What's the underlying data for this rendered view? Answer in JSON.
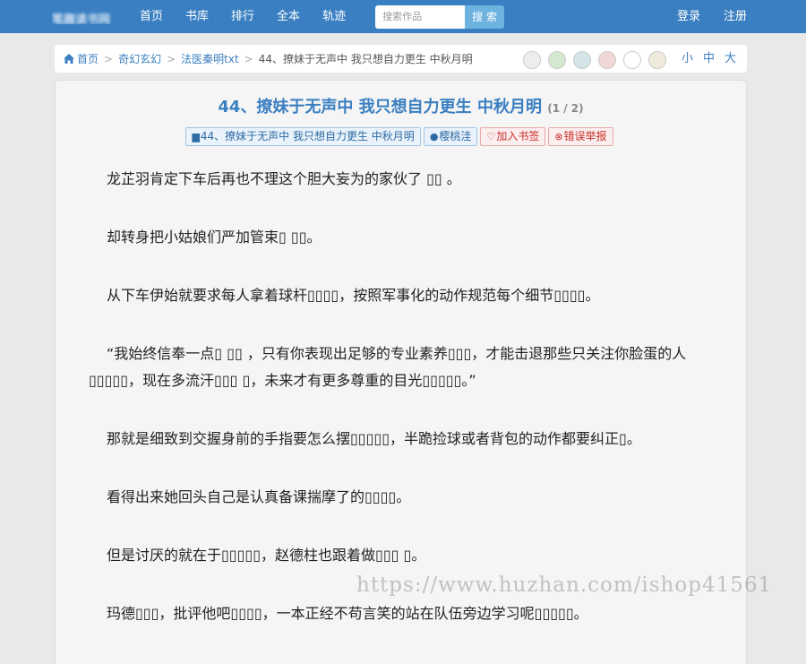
{
  "logo": {
    "text": "笔趣读书网"
  },
  "nav": [
    "首页",
    "书库",
    "排行",
    "全本",
    "轨迹"
  ],
  "search": {
    "placeholder": "搜索作品",
    "button": "搜 索"
  },
  "auth": {
    "login": "登录",
    "register": "注册"
  },
  "breadcrumb": {
    "home": "首页",
    "category": "奇幻玄幻",
    "book": "法医秦明txt",
    "chapter": "44、撩妹于无声中 我只想自力更生 中秋月明"
  },
  "themes": [
    "#eeeeee",
    "#d4e7cf",
    "#d3e3e8",
    "#f1d7d7",
    "#ffffff",
    "#f0eadc"
  ],
  "font_sizes": [
    "小",
    "中",
    "大"
  ],
  "chapter": {
    "title": "44、撩妹于无声中 我只想自力更生 中秋月明",
    "page": "(1 / 2)",
    "book_tag": "44、撩妹于无声中 我只想自力更生 中秋月明",
    "author": "樱桃洼",
    "bookmark": "加入书签",
    "report": "错误举报"
  },
  "paragraphs": [
    "龙芷羽肯定下车后再也不理这个胆大妄为的家伙了 ▯▯ 。",
    "却转身把小姑娘们严加管束▯ ▯▯。",
    "从下车伊始就要求每人拿着球杆▯▯▯▯，按照军事化的动作规范每个细节▯▯▯▯。",
    "“我始终信奉一点▯ ▯▯ ，只有你表现出足够的专业素养▯▯▯，才能击退那些只关注你脸蛋的人▯▯▯▯▯，现在多流汗▯▯▯ ▯，未来才有更多尊重的目光▯▯▯▯▯。”",
    "那就是细致到交握身前的手指要怎么摆▯▯▯▯▯，半跪捡球或者背包的动作都要纠正▯。",
    "看得出来她回头自己是认真备课揣摩了的▯▯▯▯。",
    "但是讨厌的就在于▯▯▯▯▯，赵德柱也跟着做▯▯▯ ▯。",
    "玛德▯▯▯，批评他吧▯▯▯▯，一本正经不苟言笑的站在队伍旁边学习呢▯▯▯▯▯。"
  ],
  "watermark": "https://www.huzhan.com/ishop41561"
}
